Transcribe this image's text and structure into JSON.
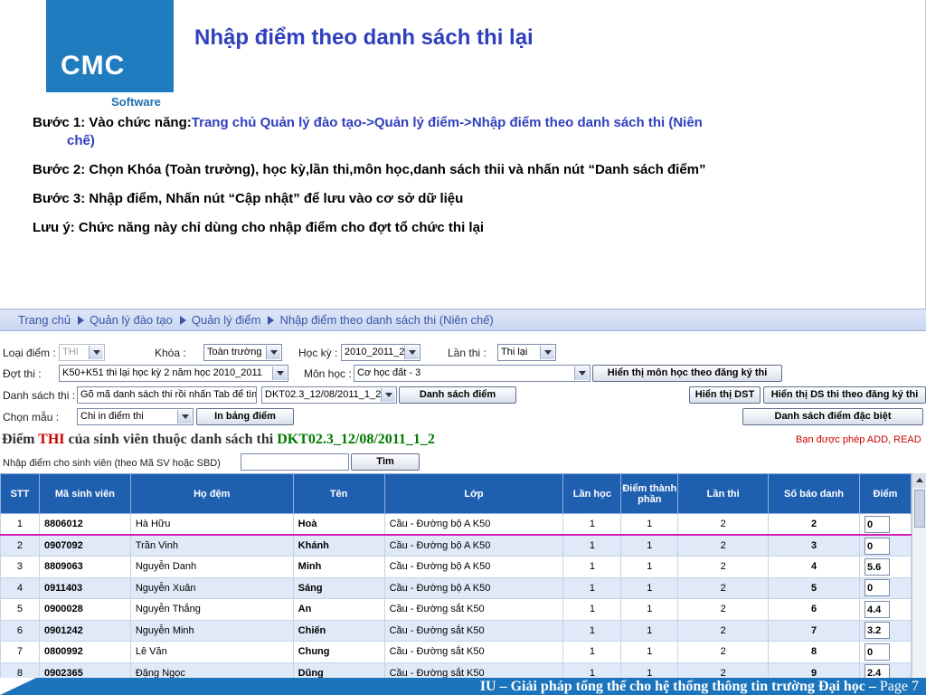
{
  "slide": {
    "logo_text": "CMC",
    "logo_sub": "Software",
    "title": "Nhập điểm theo danh sách thi lại",
    "step1_prefix": "Bước 1: Vào chức năng:",
    "step1_path": "Trang chủ Quản lý đào tạo->Quản lý điểm->Nhập điểm theo danh sách thi (Niên",
    "step1_path_cont": "chế)",
    "step2": "Bước 2: Chọn Khóa (Toàn trường), học kỳ,lần thi,môn học,danh sách thii và nhấn nút “Danh sách điểm”",
    "step3": "Bước 3: Nhập điểm, Nhấn nút “Cập nhật” để lưu vào cơ sở dữ liệu",
    "note": "Lưu ý: Chức năng này chỉ dùng cho nhập điểm cho đợt tổ chức thi lại"
  },
  "breadcrumb": [
    "Trang chủ",
    "Quản lý đào tạo",
    "Quản lý điểm",
    "Nhập điểm theo danh sách thi (Niên chế)"
  ],
  "form": {
    "loai_diem_label": "Loại điểm :",
    "loai_diem_value": "THI",
    "khoa_label": "Khóa :",
    "khoa_value": "Toàn trường",
    "hoc_ky_label": "Học kỳ :",
    "hoc_ky_value": "2010_2011_2",
    "lan_thi_label": "Lần thi :",
    "lan_thi_value": "Thi lại",
    "dot_thi_label": "Đợt thi :",
    "dot_thi_value": "K50+K51 thi lại học kỳ 2 năm học 2010_2011",
    "mon_hoc_label": "Môn học :",
    "mon_hoc_value": "Cơ học đất - 3",
    "btn_hien_thi_mon": "Hiển thị môn học theo đăng ký thi",
    "dstt_label": "Danh sách thi :",
    "dstt_search_value": "Gõ mã danh sách thi rồi nhấn Tab để tìm",
    "dstt_select_value": "DKT02.3_12/08/2011_1_2",
    "btn_danh_sach_diem": "Danh sách điểm",
    "btn_hien_thi_dst": "Hiển thị DST",
    "btn_hien_thi_ds_dk": "Hiển thị DS thi theo đăng ký thi",
    "chon_mau_label": "Chọn mẫu :",
    "chon_mau_value": "Chi in điểm thi",
    "btn_in_bang_diem": "In bảng điểm",
    "btn_dsd_dac_biet": "Danh sách điểm đặc biệt",
    "heading_prefix": "Điểm ",
    "heading_thi": "THI",
    "heading_mid": " của sinh viên thuộc danh sách thi ",
    "heading_code": "DKT02.3_12/08/2011_1_2",
    "permission": "Bạn được phép ADD, READ",
    "search_label": "Nhập điểm cho sinh viên (theo Mã SV hoặc SBD)",
    "search_value": "",
    "btn_tim": "Tìm"
  },
  "table": {
    "headers": [
      "STT",
      "Mã sinh viên",
      "Họ đệm",
      "Tên",
      "Lớp",
      "Lần học",
      "Điểm thành phần",
      "Lần thi",
      "Số báo danh",
      "Điểm"
    ],
    "rows": [
      {
        "stt": "1",
        "ma": "8806012",
        "ho": "Hà Hữu",
        "ten": "Hoà",
        "lop": "Cầu - Đường bộ A K50",
        "lan_hoc": "1",
        "dtp": "1",
        "lan_thi": "2",
        "sbd": "2",
        "diem": "0"
      },
      {
        "stt": "2",
        "ma": "0907092",
        "ho": "Trần Vinh",
        "ten": "Khánh",
        "lop": "Cầu - Đường bộ A K50",
        "lan_hoc": "1",
        "dtp": "1",
        "lan_thi": "2",
        "sbd": "3",
        "diem": "0"
      },
      {
        "stt": "3",
        "ma": "8809063",
        "ho": "Nguyễn Danh",
        "ten": "Minh",
        "lop": "Cầu - Đường bộ A K50",
        "lan_hoc": "1",
        "dtp": "1",
        "lan_thi": "2",
        "sbd": "4",
        "diem": "5.6"
      },
      {
        "stt": "4",
        "ma": "0911403",
        "ho": "Nguyễn Xuân",
        "ten": "Sáng",
        "lop": "Cầu - Đường bộ A K50",
        "lan_hoc": "1",
        "dtp": "1",
        "lan_thi": "2",
        "sbd": "5",
        "diem": "0"
      },
      {
        "stt": "5",
        "ma": "0900028",
        "ho": "Nguyễn Thắng",
        "ten": "An",
        "lop": "Cầu - Đường sắt K50",
        "lan_hoc": "1",
        "dtp": "1",
        "lan_thi": "2",
        "sbd": "6",
        "diem": "4.4"
      },
      {
        "stt": "6",
        "ma": "0901242",
        "ho": "Nguyễn Minh",
        "ten": "Chiến",
        "lop": "Cầu - Đường sắt K50",
        "lan_hoc": "1",
        "dtp": "1",
        "lan_thi": "2",
        "sbd": "7",
        "diem": "3.2"
      },
      {
        "stt": "7",
        "ma": "0800992",
        "ho": "Lê Văn",
        "ten": "Chung",
        "lop": "Cầu - Đường sắt K50",
        "lan_hoc": "1",
        "dtp": "1",
        "lan_thi": "2",
        "sbd": "8",
        "diem": "0"
      },
      {
        "stt": "8",
        "ma": "0902365",
        "ho": "Đặng Ngọc",
        "ten": "Dũng",
        "lop": "Cầu - Đường sắt K50",
        "lan_hoc": "1",
        "dtp": "1",
        "lan_thi": "2",
        "sbd": "9",
        "diem": "2.4"
      }
    ]
  },
  "footer": {
    "text": "IU – Giải pháp tổng thể cho hệ thống thông tin trường Đại học – ",
    "page": "Page 7"
  },
  "colors": {
    "title_blue": "#2f3fbd",
    "header_blue": "#1f5fb0",
    "footer_blue": "#1c75bc",
    "row_alt": "#dfe9f7",
    "highlight_line": "#d01fb8",
    "thi_red": "#cc0000",
    "code_green": "#007a00"
  }
}
